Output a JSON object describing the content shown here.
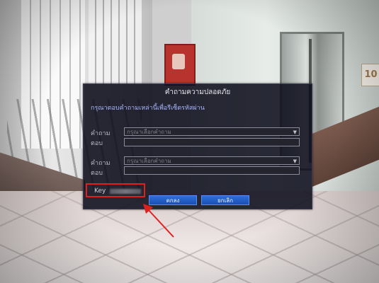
{
  "dialog": {
    "title": "คำถามความปลอดภัย",
    "hint": "กรุณาตอบคำถามเหล่านี้เพื่อรีเซ็ตรหัสผ่าน",
    "question1_label": "คำถาม",
    "question1_placeholder": "กรุณาเลือกคำถาม",
    "answer1_label": "ตอบ",
    "answer1_value": "",
    "question2_label": "คำถาม",
    "question2_placeholder": "กรุณาเลือกคำถาม",
    "answer2_label": "ตอบ",
    "answer2_value": "",
    "key_label": "Key",
    "ok_button": "ตกลง",
    "cancel_button": "ยกเลิก"
  },
  "scene": {
    "floor_sign": "10"
  },
  "colors": {
    "highlight_box": "#e02020",
    "annotation_arrow": "#e02020",
    "button_blue": "#1b4fb4",
    "hint_text": "#a9b7ff"
  }
}
